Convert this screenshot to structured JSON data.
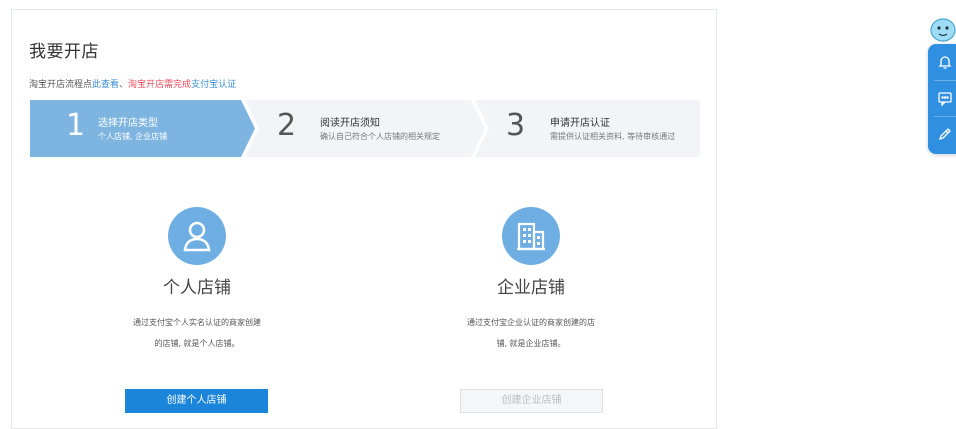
{
  "page": {
    "title": "我要开店",
    "subline": {
      "prefix": "淘宝开店流程点",
      "link1": "此查看",
      "sep": "、",
      "warn": "淘宝开店需完成",
      "link2": "支付宝认证"
    }
  },
  "steps": [
    {
      "num": "1",
      "title": "选择开店类型",
      "desc": "个人店铺, 企业店铺"
    },
    {
      "num": "2",
      "title": "阅读开店须知",
      "desc": "确认自己符合个人店铺的相关规定"
    },
    {
      "num": "3",
      "title": "申请开店认证",
      "desc": "需提供认证相关资料, 等待审核通过"
    }
  ],
  "cards": {
    "personal": {
      "name": "个人店铺",
      "desc1": "通过支付宝个人实名认证的商家创建",
      "desc2": "的店铺, 就是个人店铺。",
      "button": "创建个人店铺",
      "icon": "person-icon"
    },
    "company": {
      "name": "企业店铺",
      "desc1": "通过支付宝企业认证的商家创建的店",
      "desc2": "铺, 就是企业店铺。",
      "button": "创建企业店铺",
      "icon": "building-icon"
    }
  },
  "float_bar": {
    "icons": [
      "bell-icon",
      "chat-icon",
      "edit-icon"
    ],
    "mascot": "mascot-icon"
  },
  "colors": {
    "accent": "#1b86d9",
    "step_active": "#7eb4e0",
    "icon_circle": "#6faee3",
    "warn": "#e94b59"
  }
}
